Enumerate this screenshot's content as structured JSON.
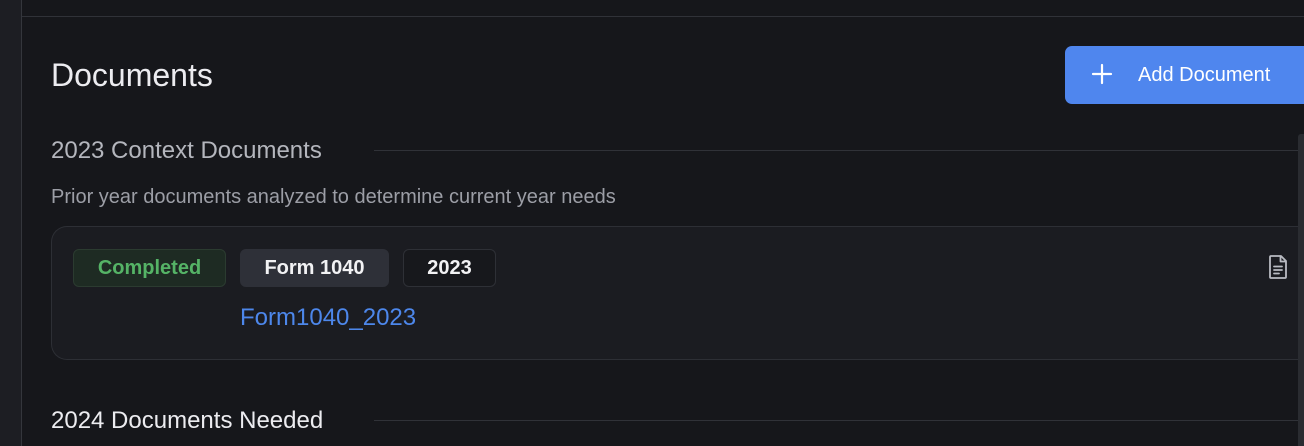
{
  "header": {
    "title": "Documents",
    "add_button_label": "Add Document",
    "add_icon": "plus-icon",
    "accent_color": "#4f86ee"
  },
  "sections": [
    {
      "heading": "2023 Context Documents",
      "description": "Prior year documents analyzed to determine current year needs",
      "documents": [
        {
          "status": "Completed",
          "form_type": "Form 1040",
          "year": "2023",
          "file_name": "Form1040_2023",
          "icon": "document-icon",
          "status_color": "#55b366"
        }
      ]
    },
    {
      "heading": "2024 Documents Needed"
    }
  ]
}
